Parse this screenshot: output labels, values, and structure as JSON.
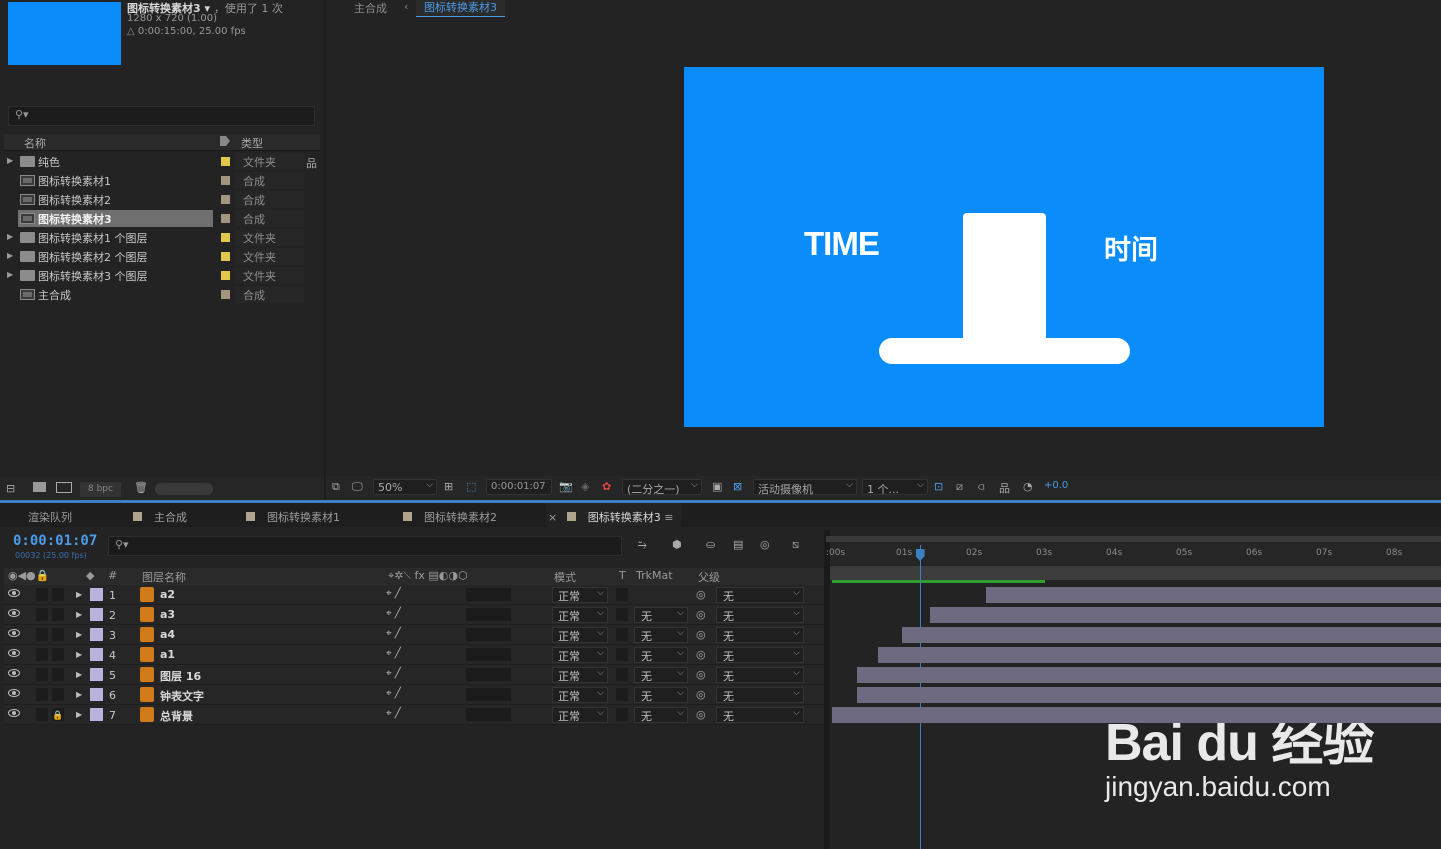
{
  "project": {
    "comp_name": "图标转换素材3",
    "comp_used": "，使用了 1 次",
    "comp_res": "1280 x 720 (1.00)",
    "comp_duration": "△ 0:00:15:00, 25.00 fps",
    "search_placeholder": "",
    "col_name": "名称",
    "col_type": "类型",
    "items": [
      {
        "name": "纯色",
        "type": "文件夹",
        "kind": "folder",
        "label_color": "#e2c84a"
      },
      {
        "name": "图标转换素材1",
        "type": "合成",
        "kind": "comp",
        "label_color": "#a39680"
      },
      {
        "name": "图标转换素材2",
        "type": "合成",
        "kind": "comp",
        "label_color": "#a39680"
      },
      {
        "name": "图标转换素材3",
        "type": "合成",
        "kind": "comp",
        "label_color": "#a39680",
        "selected": true
      },
      {
        "name": "图标转换素材1 个图层",
        "type": "文件夹",
        "kind": "folder",
        "label_color": "#e2c84a"
      },
      {
        "name": "图标转换素材2 个图层",
        "type": "文件夹",
        "kind": "folder",
        "label_color": "#e2c84a"
      },
      {
        "name": "图标转换素材3 个图层",
        "type": "文件夹",
        "kind": "folder",
        "label_color": "#e2c84a"
      },
      {
        "name": "主合成",
        "type": "合成",
        "kind": "comp",
        "label_color": "#a39680"
      }
    ],
    "bpc": "8 bpc"
  },
  "viewer": {
    "breadcrumb_root": "主合成",
    "breadcrumb_current": "图标转换素材3",
    "canvas_text_left": "TIME",
    "canvas_text_right": "时间",
    "zoom": "50%",
    "timecode": "0:00:01:07",
    "resolution": "(二分之一)",
    "camera": "活动摄像机",
    "views": "1 个...",
    "exposure": "+0.0"
  },
  "timeline": {
    "tabs": [
      "渲染队列",
      "主合成",
      "图标转换素材1",
      "图标转换素材2",
      "图标转换素材3"
    ],
    "active_tab": "图标转换素材3",
    "timecode": "0:00:01:07",
    "timecode_sub": "00032 (25.00 fps)",
    "headers": {
      "num": "#",
      "name": "图层名称",
      "mode": "模式",
      "t": "T",
      "trkmat": "TrkMat",
      "parent": "父级"
    },
    "ruler": [
      ":00s",
      "01s",
      "02s",
      "03s",
      "04s",
      "05s",
      "06s",
      "07s",
      "08s"
    ],
    "playhead_seconds": 1.28,
    "layers": [
      {
        "num": "1",
        "name": "a2",
        "mode": "正常",
        "trkmat": "",
        "parent": "无",
        "in_sec": 2.2,
        "locked": false
      },
      {
        "num": "2",
        "name": "a3",
        "mode": "正常",
        "trkmat": "无",
        "parent": "无",
        "in_sec": 1.4,
        "locked": false
      },
      {
        "num": "3",
        "name": "a4",
        "mode": "正常",
        "trkmat": "无",
        "parent": "无",
        "in_sec": 1.0,
        "locked": false
      },
      {
        "num": "4",
        "name": "a1",
        "mode": "正常",
        "trkmat": "无",
        "parent": "无",
        "in_sec": 0.65,
        "locked": false
      },
      {
        "num": "5",
        "name": "图层 16",
        "mode": "正常",
        "trkmat": "无",
        "parent": "无",
        "in_sec": 0.35,
        "locked": false
      },
      {
        "num": "6",
        "name": "钟表文字",
        "mode": "正常",
        "trkmat": "无",
        "parent": "无",
        "in_sec": 0.35,
        "locked": false
      },
      {
        "num": "7",
        "name": "总背景",
        "mode": "正常",
        "trkmat": "无",
        "parent": "无",
        "in_sec": 0.0,
        "locked": true
      }
    ]
  },
  "watermark": {
    "brand": "Bai du 经验",
    "url": "jingyan.baidu.com"
  }
}
